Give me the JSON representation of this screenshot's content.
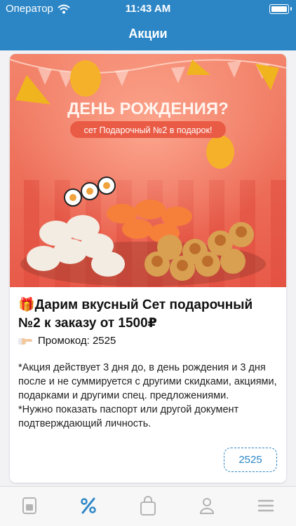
{
  "status_bar": {
    "carrier": "Оператор",
    "time": "11:43 AM",
    "icons": [
      "wifi-icon",
      "battery-icon"
    ]
  },
  "header": {
    "title": "Акции"
  },
  "promo_card": {
    "banner": {
      "headline": "ДЕНЬ РОЖДЕНИЯ?",
      "subline": "сет Подарочный №2 в подарок!"
    },
    "title": "🎁Дарим вкусный Сет подарочный №2 к заказу от 1500₽",
    "promo_label": "Промокод: 2525",
    "description": "*Акция действует 3 дня до, в день рождения и 3 дня после и не суммируется с другими скидками, акциями, подарками и другими спец. предложениями.\n*Нужно показать паспорт или другой документ подтверждающий личность.",
    "code_button": "2525"
  },
  "tab_bar": {
    "items": [
      {
        "icon": "menu-book-icon",
        "active": false
      },
      {
        "icon": "percent-icon",
        "active": true
      },
      {
        "icon": "shopping-bag-icon",
        "active": false
      },
      {
        "icon": "profile-icon",
        "active": false
      },
      {
        "icon": "more-menu-icon",
        "active": false
      }
    ]
  },
  "colors": {
    "accent": "#2c86c6",
    "inactive": "#b3b3b3",
    "banner_bg": "#f06a55",
    "background": "#f2f2f5"
  }
}
